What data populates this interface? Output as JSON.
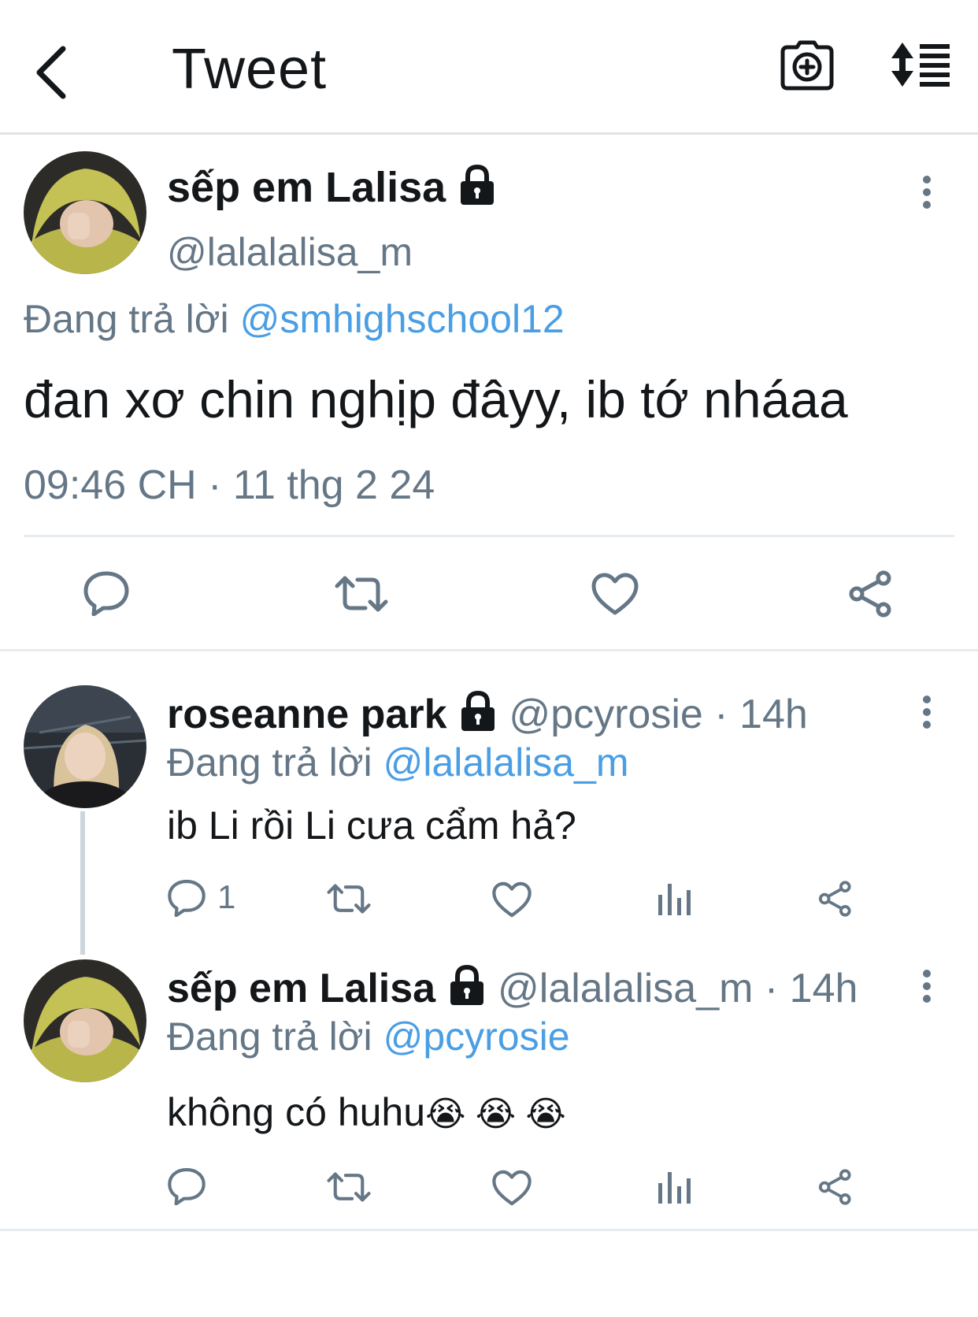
{
  "header": {
    "title": "Tweet",
    "back_icon": "chevron-left-icon",
    "camera_icon": "camera-plus-icon",
    "sort_icon": "sort-toggle-icon"
  },
  "main_tweet": {
    "display_name": "sếp em Lalisa",
    "handle": "@lalalalisa_m",
    "reply_prefix": "Đang trả lời",
    "reply_to": "@smhighschool12",
    "text": "đan xơ chin nghịp đâyy, ib tớ nháaa",
    "timestamp": "09:46 CH · 11 thg 2 24"
  },
  "replies": [
    {
      "display_name": "roseanne park",
      "handle": "@pcyrosie",
      "time": "· 14h",
      "reply_prefix": "Đang trả lời",
      "reply_to": "@lalalalisa_m",
      "text": "ib Li rồi Li cưa cẩm hả?",
      "reply_count": "1"
    },
    {
      "display_name": "sếp em Lalisa",
      "handle": "@lalalalisa_m",
      "time": "· 14h",
      "reply_prefix": "Đang trả lời",
      "reply_to": "@pcyrosie",
      "text": "không có huhu",
      "emoji": "😭 😭 😭",
      "reply_count": ""
    }
  ],
  "colors": {
    "link": "#4a9ee4",
    "muted": "#657786",
    "text": "#14171a",
    "divider": "#e6ecf0"
  }
}
